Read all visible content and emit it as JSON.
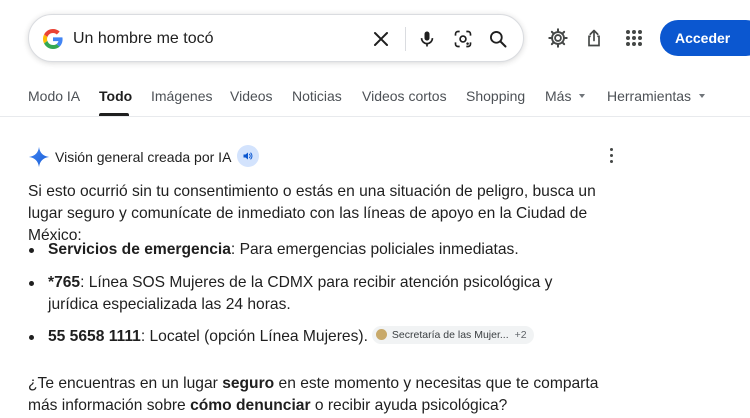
{
  "search": {
    "query": "Un hombre me tocó",
    "clear_label": "✕"
  },
  "header": {
    "signin_label": "Acceder"
  },
  "tabs": [
    {
      "label": "Modo IA"
    },
    {
      "label": "Todo"
    },
    {
      "label": "Imágenes"
    },
    {
      "label": "Videos"
    },
    {
      "label": "Noticias"
    },
    {
      "label": "Videos cortos"
    },
    {
      "label": "Shopping"
    },
    {
      "label": "Más"
    },
    {
      "label": "Herramientas"
    }
  ],
  "ai_overview": {
    "title": "Visión general creada por IA",
    "intro": "Si esto ocurrió sin tu consentimiento o estás en una situación de peligro, busca un lugar seguro y comunícate de inmediato con las líneas de apoyo en la Ciudad de México:",
    "bullets": [
      {
        "bold": "Servicios de emergencia",
        "text": ": Para emergencias policiales inmediatas."
      },
      {
        "bold": "*765",
        "text": ": Línea SOS Mujeres de la CDMX para recibir atención psicológica y jurídica especializada las 24 horas."
      },
      {
        "bold": "55 5658 1111",
        "text": ": Locatel (opción Línea Mujeres)."
      }
    ],
    "source_chip": {
      "label": "Secretaría de las Mujer...",
      "count": "+2"
    },
    "question": {
      "part1": "¿Te encuentras en un lugar ",
      "bold1": "seguro",
      "part2": " en este momento y necesitas que te comparta más información sobre ",
      "bold2": "cómo denunciar",
      "part3": " o recibir ayuda psicológica?"
    }
  },
  "colors": {
    "accent": "#0b57d0",
    "sparkle": "#4285f4",
    "text": "#1f1f1f",
    "muted": "#4d5156"
  }
}
